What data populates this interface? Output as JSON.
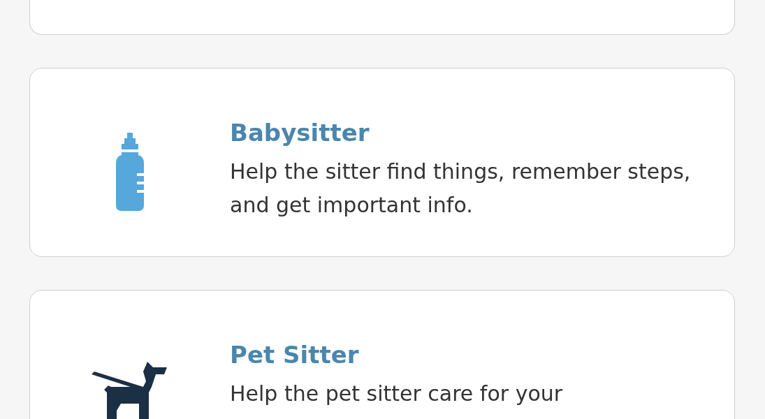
{
  "cards": [
    {
      "kind": "cut"
    },
    {
      "kind": "bottle",
      "title": "Babysitter",
      "description": "Help the sitter find things, remember steps, and get important info."
    },
    {
      "kind": "dog",
      "title": "Pet Sitter",
      "description": "Help the pet sitter care for your"
    }
  ]
}
